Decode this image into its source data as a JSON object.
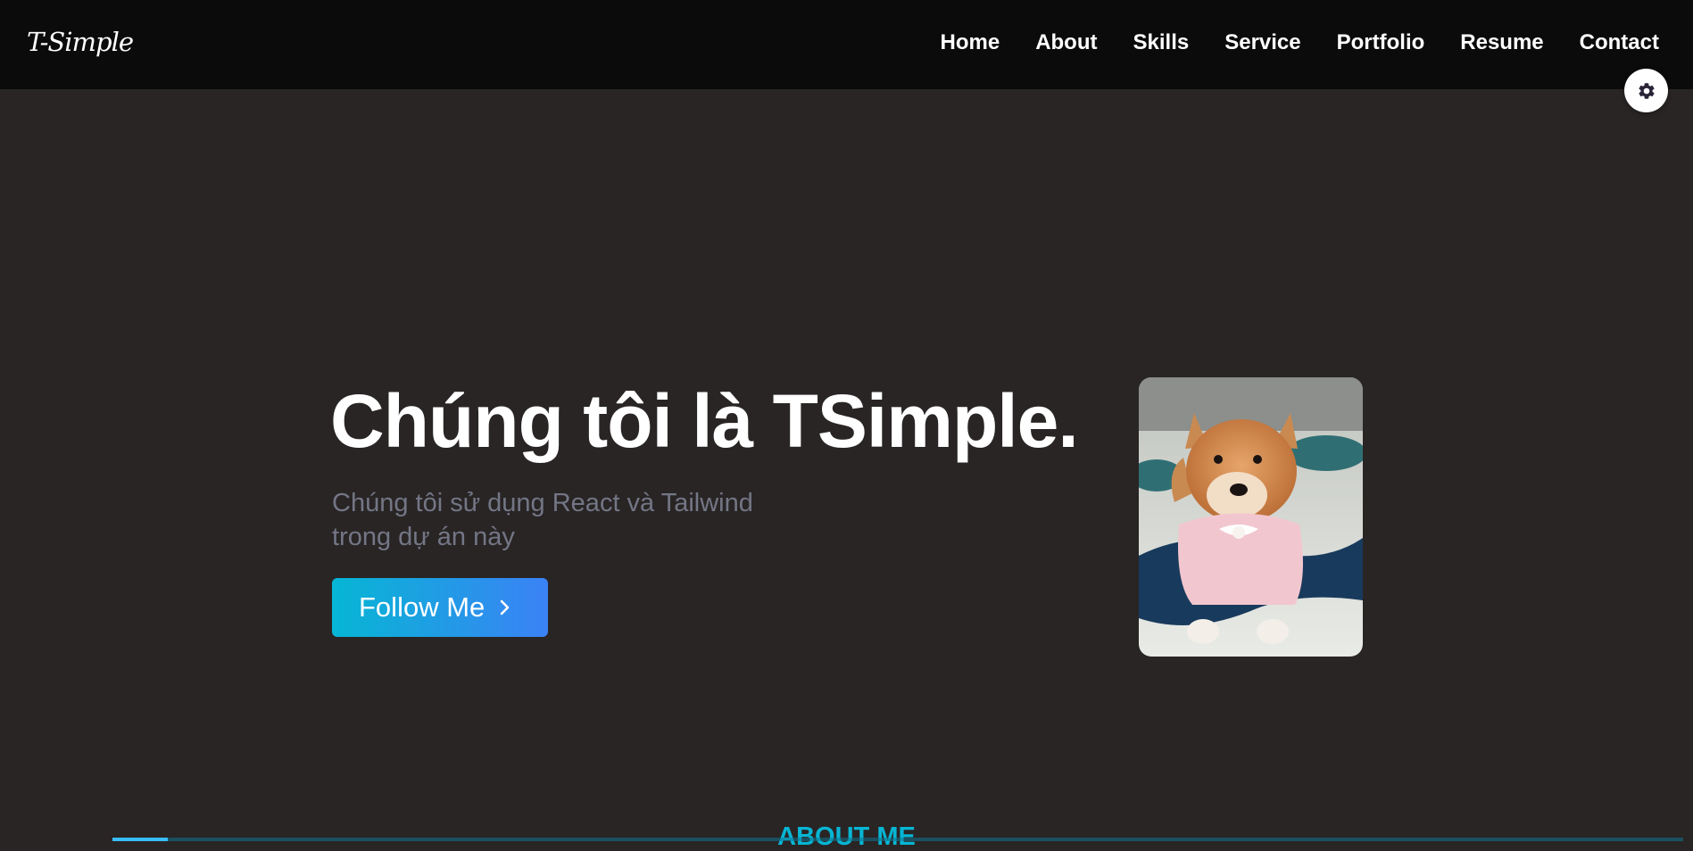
{
  "header": {
    "logo": "T-Simple",
    "nav": [
      "Home",
      "About",
      "Skills",
      "Service",
      "Portfolio",
      "Resume",
      "Contact"
    ]
  },
  "settings": {
    "icon": "gear-icon"
  },
  "hero": {
    "title": "Chúng tôi là TSimple.",
    "subtitle": "Chúng tôi sử dụng React và Tailwind trong dự án này",
    "button_label": "Follow Me",
    "button_icon": "chevron-right-icon"
  },
  "about": {
    "heading": "ABOUT ME"
  },
  "colors": {
    "navbar_bg": "#0b0b0b",
    "page_bg": "#292525",
    "accent": "#06b6d4",
    "accent_gradient_end": "#3b82f6",
    "subtitle": "#737685"
  }
}
